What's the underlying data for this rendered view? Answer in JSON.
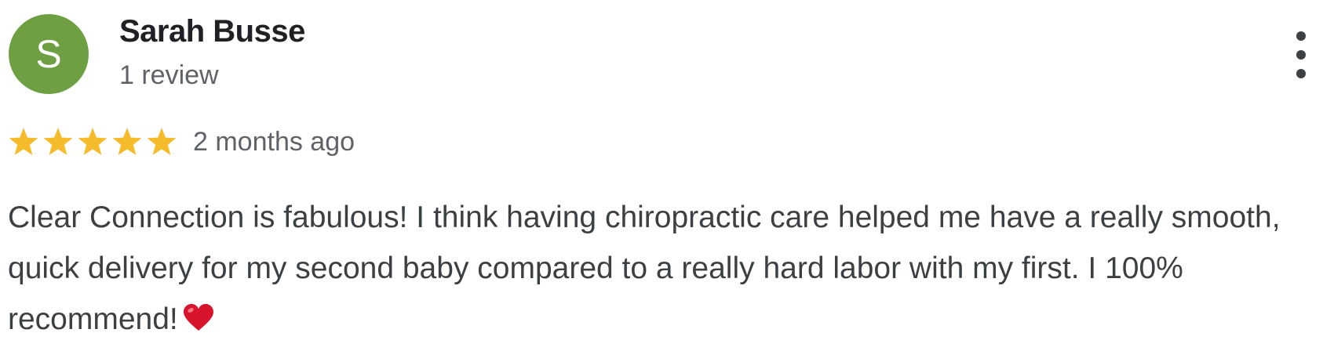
{
  "reviewer": {
    "avatar_initial": "S",
    "avatar_color": "#6ea043",
    "name": "Sarah Busse",
    "review_count": "1 review"
  },
  "review": {
    "rating": 5,
    "rating_max": 5,
    "star_color": "#f6bb2a",
    "time_ago": "2 months ago",
    "text": "Clear Connection is fabulous! I think having chiropractic care helped me have a really smooth, quick delivery for my second baby compared to a really hard labor with my first. I 100% recommend!",
    "emoji": "red-heart-icon"
  },
  "menu": {
    "icon": "more-vertical-icon"
  }
}
